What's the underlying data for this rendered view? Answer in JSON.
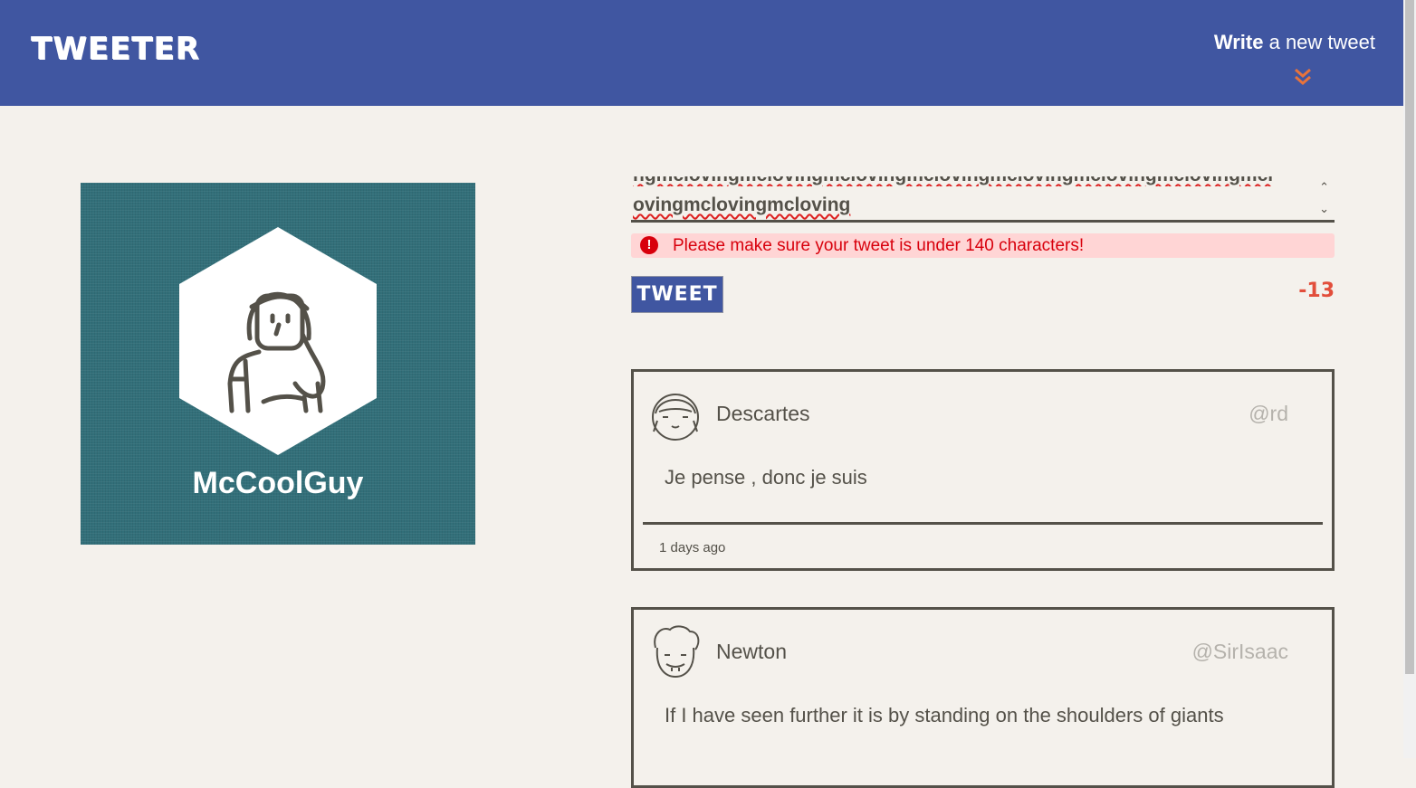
{
  "header": {
    "brand": "TWEETER",
    "compose_bold": "Write",
    "compose_rest": " a new tweet"
  },
  "profile": {
    "name": "McCoolGuy",
    "avatar_icon": "girl-avatar-icon"
  },
  "composer": {
    "text_line1": "ngmclovingmclovingmclovingmclovingmclovingmclovingmclovingmcl",
    "text_line2": "ovingmclovingmcloving",
    "error_message": "Please make sure your tweet is under 140 characters!",
    "error_icon": "!",
    "tweet_button": "TWEET",
    "counter": "-13"
  },
  "tweets": [
    {
      "name": "Descartes",
      "handle": "@rd",
      "content": "Je pense , donc je suis",
      "time": "1 days ago"
    },
    {
      "name": "Newton",
      "handle": "@SirIsaac",
      "content": "If I have seen further it is by standing on the shoulders of giants"
    }
  ],
  "colors": {
    "nav": "#4056a1",
    "background": "#f4f1ec",
    "profile": "#326f79",
    "accent": "#e24e3b",
    "error": "#d8000c"
  }
}
